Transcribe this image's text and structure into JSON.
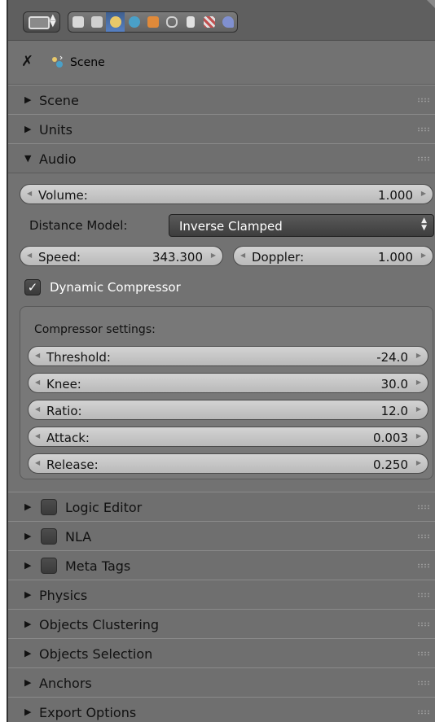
{
  "header": {
    "editor_icon": "properties-editor-icon",
    "context_tabs": [
      {
        "name": "render-icon",
        "color": "#d8d8d8"
      },
      {
        "name": "render-layers-icon",
        "color": "#cfcfcf"
      },
      {
        "name": "scene-icon",
        "color": "#e8c86a",
        "selected": true
      },
      {
        "name": "world-icon",
        "color": "#4aa0c8"
      },
      {
        "name": "object-icon",
        "color": "#e08a3a"
      },
      {
        "name": "constraints-icon",
        "color": "#d0d0d0"
      },
      {
        "name": "speaker-icon",
        "color": "#e0e0e0"
      },
      {
        "name": "texture-icon",
        "color": "#c05050"
      },
      {
        "name": "brush-icon",
        "color": "#8090d0"
      }
    ]
  },
  "path": {
    "pin_icon": "pin-icon",
    "scene_icon": "scene-icon",
    "label": "Scene"
  },
  "panels_top": [
    {
      "label": "Scene",
      "collapsed": true
    },
    {
      "label": "Units",
      "collapsed": true
    },
    {
      "label": "Audio",
      "collapsed": false
    }
  ],
  "audio": {
    "volume": {
      "label": "Volume:",
      "value": "1.000"
    },
    "distance_model": {
      "label": "Distance Model:",
      "value": "Inverse Clamped"
    },
    "speed": {
      "label": "Speed:",
      "value": "343.300"
    },
    "doppler": {
      "label": "Doppler:",
      "value": "1.000"
    },
    "dynamic_compressor": {
      "label": "Dynamic Compressor",
      "checked": true
    },
    "compressor": {
      "heading": "Compressor settings:",
      "fields": [
        {
          "label": "Threshold:",
          "value": "-24.0"
        },
        {
          "label": "Knee:",
          "value": "30.0"
        },
        {
          "label": "Ratio:",
          "value": "12.0"
        },
        {
          "label": "Attack:",
          "value": "0.003"
        },
        {
          "label": "Release:",
          "value": "0.250"
        }
      ]
    }
  },
  "panels_bottom": [
    {
      "label": "Logic Editor",
      "has_checkbox": true
    },
    {
      "label": "NLA",
      "has_checkbox": true
    },
    {
      "label": "Meta Tags",
      "has_checkbox": true
    },
    {
      "label": "Physics",
      "has_checkbox": false
    },
    {
      "label": "Objects Clustering",
      "has_checkbox": false
    },
    {
      "label": "Objects Selection",
      "has_checkbox": false
    },
    {
      "label": "Anchors",
      "has_checkbox": false
    },
    {
      "label": "Export Options",
      "has_checkbox": false
    }
  ]
}
